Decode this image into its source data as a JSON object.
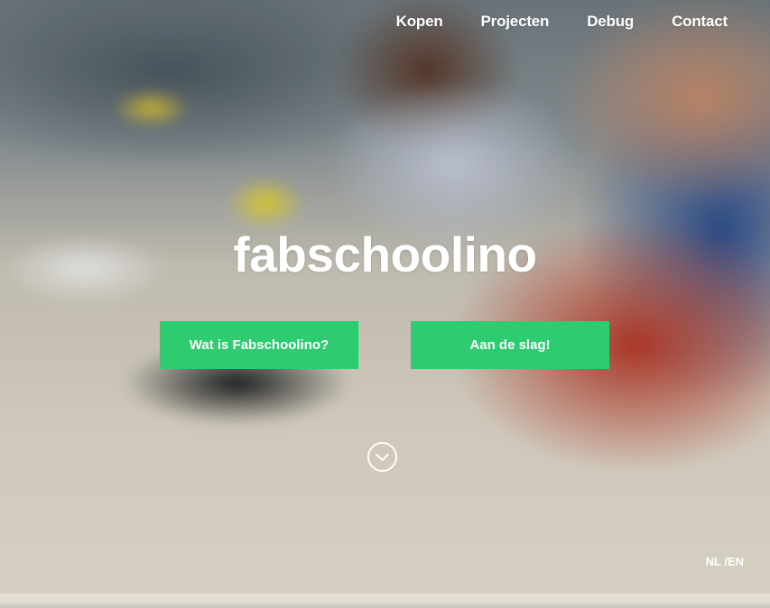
{
  "nav": {
    "items": [
      {
        "label": "Kopen"
      },
      {
        "label": "Projecten"
      },
      {
        "label": "Debug"
      },
      {
        "label": "Contact"
      }
    ]
  },
  "hero": {
    "logo_text": "fabschoolino",
    "buttons": {
      "left_label": "Wat is Fabschoolino?",
      "right_label": "Aan de slag!"
    },
    "scroll_icon": "chevron-down-circle-icon"
  },
  "language": {
    "nl": "NL",
    "separator": " /",
    "en": "EN"
  },
  "colors": {
    "accent": "#2ecc71",
    "text": "#ffffff"
  }
}
